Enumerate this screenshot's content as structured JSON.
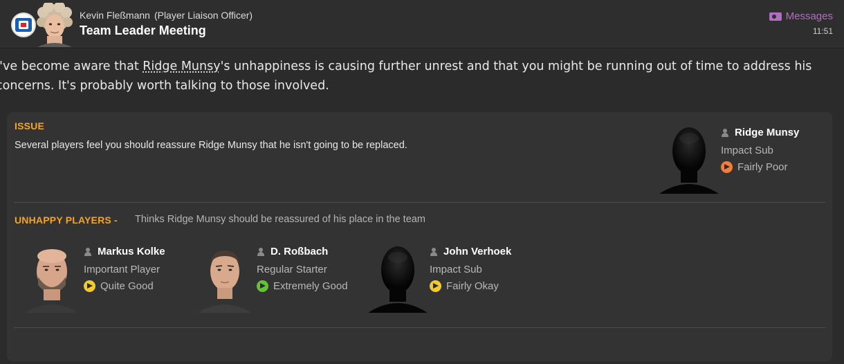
{
  "header": {
    "sender_name": "Kevin Fleßmann",
    "sender_role": "(Player Liaison Officer)",
    "subject": "Team Leader Meeting",
    "messages_label": "Messages",
    "time": "11:51",
    "accent_color": "#b06ec2"
  },
  "message": {
    "text_before": "I've become aware that ",
    "link_name": "Ridge Munsy",
    "text_after": "'s unhappiness is causing further unrest and that you might be running out of time to address his concerns. It's probably worth talking to those involved."
  },
  "issue": {
    "title": "ISSUE",
    "description": "Several players feel you should reassure Ridge Munsy that he isn't going to be replaced.",
    "player": {
      "name": "Ridge Munsy",
      "status": "Impact Sub",
      "morale": "Fairly Poor",
      "morale_color": "#ef7f3a"
    }
  },
  "unhappy": {
    "title": "UNHAPPY PLAYERS -",
    "subtitle": "Thinks Ridge Munsy should be reassured of his place in the team",
    "players": [
      {
        "name": "Markus Kolke",
        "status": "Important Player",
        "morale": "Quite Good",
        "morale_color": "#f2cb2b",
        "icon": "bald-player-portrait"
      },
      {
        "name": "D. Roßbach",
        "status": "Regular Starter",
        "morale": "Extremely Good",
        "morale_color": "#62c431",
        "icon": "player-portrait"
      },
      {
        "name": "John Verhoek",
        "status": "Impact Sub",
        "morale": "Fairly Okay",
        "morale_color": "#f2cb2b",
        "icon": "silhouette"
      }
    ]
  },
  "colors": {
    "section_title": "#f2a52b",
    "panel_bg": "#333333",
    "page_bg": "#2b2b2b"
  }
}
